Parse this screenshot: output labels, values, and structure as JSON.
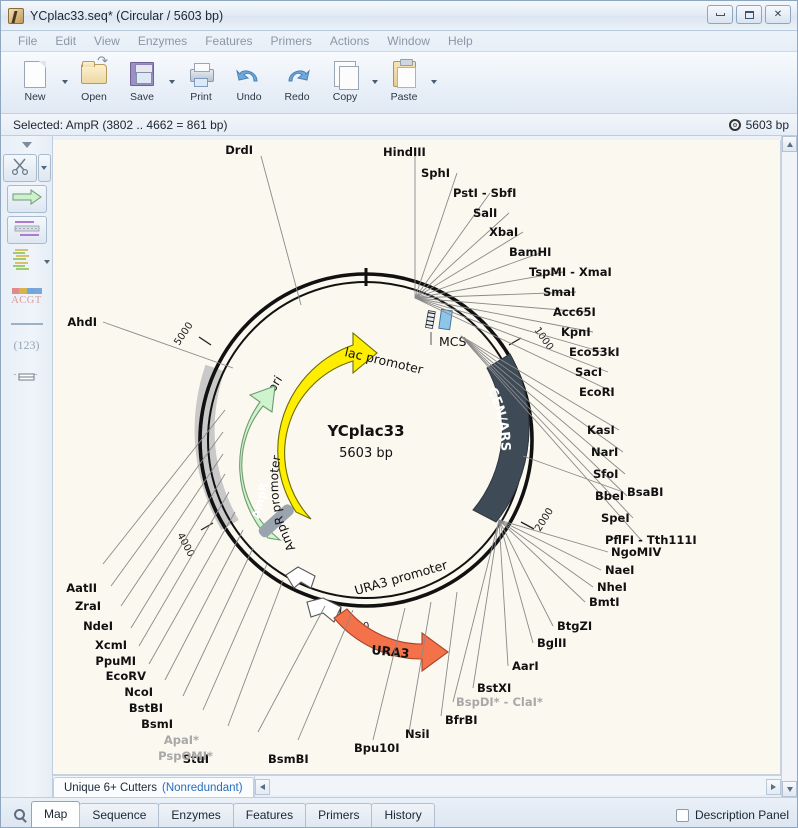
{
  "window": {
    "title": "YCplac33.seq* (Circular / 5603 bp)",
    "app_icon": "dna-document-icon",
    "controls": {
      "minimize": "minimize-icon",
      "maximize": "maximize-icon",
      "close": "close-icon"
    }
  },
  "menu": [
    "File",
    "Edit",
    "View",
    "Enzymes",
    "Features",
    "Primers",
    "Actions",
    "Window",
    "Help"
  ],
  "toolbar": [
    {
      "label": "New",
      "icon": "new-document-icon",
      "caret": true
    },
    {
      "label": "Open",
      "icon": "open-folder-icon",
      "caret": false
    },
    {
      "label": "Save",
      "icon": "save-floppy-icon",
      "caret": true
    },
    {
      "label": "Print",
      "icon": "printer-icon",
      "caret": false
    },
    {
      "label": "Undo",
      "icon": "undo-arrow-icon",
      "caret": false
    },
    {
      "label": "Redo",
      "icon": "redo-arrow-icon",
      "caret": false
    },
    {
      "label": "Copy",
      "icon": "copy-pages-icon",
      "caret": true
    },
    {
      "label": "Paste",
      "icon": "paste-clipboard-icon",
      "caret": true
    }
  ],
  "status": {
    "selection": "Selected: AmpR (3802 .. 4662 = 861 bp)",
    "length": "5603 bp",
    "topology_icon": "circular-plasmid-icon"
  },
  "rail": [
    {
      "name": "collapse-caret",
      "icon": "chevron-down-icon"
    },
    {
      "name": "cut-tool",
      "icon": "scissors-icon",
      "caret": true
    },
    {
      "name": "feature-tool",
      "icon": "green-arrow-icon"
    },
    {
      "name": "primer-tool",
      "icon": "primer-lines-icon"
    },
    {
      "name": "alignment-tool",
      "icon": "sequence-lines-icon",
      "caret": true
    },
    {
      "name": "translation-tool",
      "icon": "acgt-icon",
      "text": "ACGT"
    },
    {
      "name": "numbering-tool",
      "icon": "numbering-icon",
      "text": "(123)"
    },
    {
      "name": "ruler-tool",
      "icon": "ruler-icon"
    }
  ],
  "filter": {
    "tab_label": "Unique 6+ Cutters",
    "tab_sub": "(Nonredundant)"
  },
  "tabs": [
    {
      "label": "Map",
      "active": true
    },
    {
      "label": "Sequence",
      "active": false
    },
    {
      "label": "Enzymes",
      "active": false
    },
    {
      "label": "Features",
      "active": false
    },
    {
      "label": "Primers",
      "active": false
    },
    {
      "label": "History",
      "active": false
    }
  ],
  "description_panel": {
    "label": "Description Panel",
    "checked": false
  },
  "map": {
    "plasmid_name": "YCplac33",
    "plasmid_size": "5603 bp",
    "tick_labels": [
      "1000",
      "2000",
      "3000",
      "4000",
      "5000"
    ],
    "features": [
      {
        "name": "ori",
        "color": "#ffee00",
        "text_color": "#111"
      },
      {
        "name": "AmpR",
        "color": "#c8f2c8",
        "text_color": "#ffffff"
      },
      {
        "name": "AmpR promoter",
        "color": "#ffffff",
        "text_color": "#111"
      },
      {
        "name": "URA3",
        "color": "#f4724a",
        "text_color": "#111"
      },
      {
        "name": "URA3 promoter",
        "color": "#ffffff",
        "text_color": "#111"
      },
      {
        "name": "CEN/ARS",
        "color": "#3f4a57",
        "text_color": "#ffffff"
      },
      {
        "name": "lac promoter",
        "color": "#ffffff",
        "text_color": "#111"
      },
      {
        "name": "MCS",
        "color": "#8ec6ea",
        "text_color": "#111"
      }
    ],
    "enzymes_top_right": [
      "HindIII",
      "SphI",
      "PstI - SbfI",
      "SalI",
      "XbaI",
      "BamHI",
      "TspMI - XmaI",
      "SmaI",
      "Acc65I",
      "KpnI",
      "Eco53kI",
      "SacI",
      "EcoRI"
    ],
    "enzymes_right_upper": [
      "KasI",
      "NarI",
      "SfoI",
      "BbeI",
      "SpeI",
      "PflFI - Tth111I"
    ],
    "enzymes_right_mid": [
      "BsaBI"
    ],
    "enzymes_right_lower": [
      "NgoMIV",
      "NaeI",
      "NheI",
      "BmtI",
      "BtgZI",
      "BglII",
      "AarI",
      "BstXI"
    ],
    "enzymes_bottom_right": [
      "BspDI* - ClaI*",
      "BfrBI",
      "NsiI",
      "Bpu10I"
    ],
    "enzymes_bottom": [
      "BsmBI",
      "StuI"
    ],
    "enzymes_left": [
      "AatII",
      "ZraI",
      "NdeI",
      "XcmI",
      "PpuMI",
      "EcoRV",
      "NcoI",
      "BstBI",
      "BsmI",
      "ApaI*",
      "PspOMI*"
    ],
    "enzymes_top_left": [
      "DrdI",
      "AhdI"
    ],
    "dimmed_enzymes": [
      "BspDI* - ClaI*",
      "ApaI*",
      "PspOMI*"
    ],
    "selection_arc_color": "#c9c9c9",
    "background": "#fbf8f0"
  }
}
